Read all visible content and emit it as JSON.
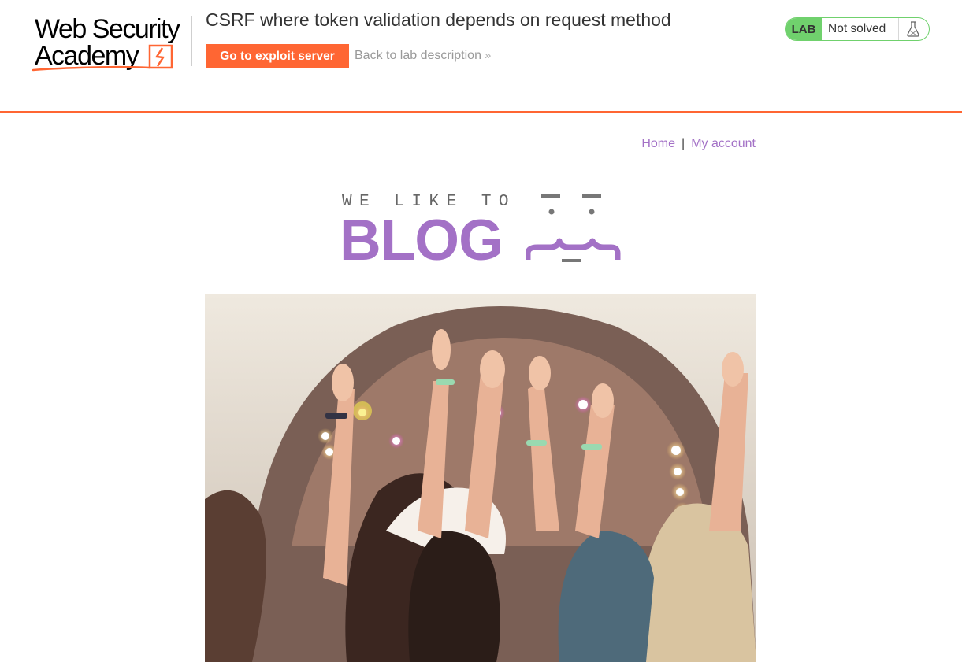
{
  "header": {
    "logo": {
      "line1": "Web Security",
      "line2": "Academy"
    },
    "lab_title": "CSRF where token validation depends on request method",
    "exploit_button": "Go to exploit server",
    "back_link": "Back to lab description",
    "back_chevrons": "»",
    "status": {
      "badge": "LAB",
      "text": "Not solved",
      "icon": "flask-icon"
    },
    "colors": {
      "accent": "#ff6633",
      "solved_green": "#70d16d"
    }
  },
  "nav": {
    "home": "Home",
    "separator": "|",
    "account": "My account",
    "link_color": "#a371c6"
  },
  "blog_logo": {
    "tagline": "WE LIKE TO",
    "word": "BLOG",
    "color": "#a371c6"
  },
  "hero_image": {
    "subject": "crowd-at-concert"
  }
}
